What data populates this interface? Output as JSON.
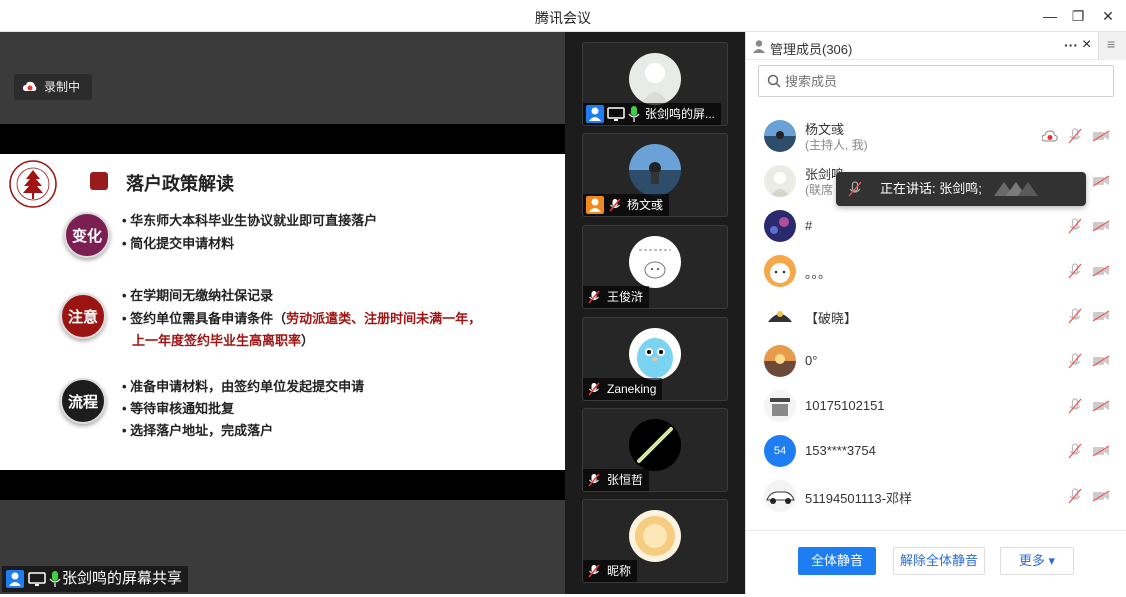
{
  "window": {
    "title": "腾讯会议"
  },
  "main": {
    "recording_label": "录制中",
    "slide": {
      "title": "落户政策解读",
      "sections": [
        {
          "badge": "变化",
          "badge_color": "#7b1f52",
          "lines": [
            "• 华东师大本科毕业生协议就业即可直接落户",
            "• 简化提交申请材料"
          ]
        },
        {
          "badge": "注意",
          "badge_color": "#9a1414",
          "lines": [
            "• 在学期间无缴纳社保记录",
            "• 签约单位需具备申请条件（",
            "劳动派遣类、注册时间未满一年，",
            "上一年度签约毕业生高离职率",
            "）"
          ]
        },
        {
          "badge": "流程",
          "badge_color": "#1d1d1d",
          "lines": [
            "• 准备申请材料，由签约单位发起提交申请",
            "• 等待审核通知批复",
            "• 选择落户地址，完成落户"
          ]
        }
      ]
    },
    "sharer_label": "张剑鸣的屏幕共享"
  },
  "thumbnails": [
    {
      "name": "张剑鸣的屏...",
      "mic": "on",
      "sharing": true
    },
    {
      "name": "杨文彧",
      "mic": "off",
      "host": true
    },
    {
      "name": "王俊浒",
      "mic": "off"
    },
    {
      "name": "Zaneking",
      "mic": "off"
    },
    {
      "name": "张恒哲",
      "mic": "off"
    },
    {
      "name": "昵称",
      "mic": "off"
    }
  ],
  "panel": {
    "title": "管理成员(306)",
    "more_label": "···",
    "close_label": "×",
    "menu_label": "≡",
    "search_placeholder": "搜索成员",
    "members": [
      {
        "name": "杨文彧",
        "sub": "(主持人, 我)",
        "recording": true
      },
      {
        "name": "张剑鸣",
        "sub": "(联席"
      },
      {
        "name": "#"
      },
      {
        "name": "。。。"
      },
      {
        "name": "【破晓】"
      },
      {
        "name": "0°"
      },
      {
        "name": "10175102151"
      },
      {
        "name": "153****3754",
        "avatar_text": "54",
        "avatar_color": "#1e7df0"
      },
      {
        "name": "51194501113-邓样"
      }
    ],
    "speaking_tip": "正在讲话: 张剑鸣;",
    "buttons": {
      "mute_all": "全体静音",
      "unmute_all": "解除全体静音",
      "more": "更多 ▾"
    }
  }
}
